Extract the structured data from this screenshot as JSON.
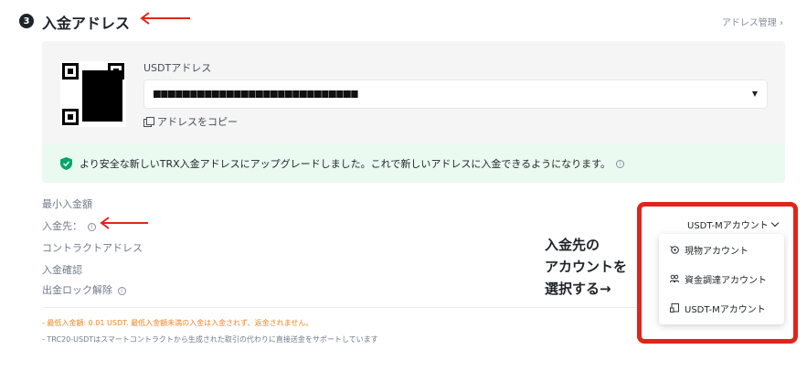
{
  "step": {
    "number": "3",
    "title": "入金アドレス"
  },
  "header": {
    "address_management": "アドレス管理 ›"
  },
  "address": {
    "label": "USDTアドレス",
    "copy_label": "アドレスをコピー"
  },
  "notice": {
    "text": "より安全な新しいTRX入金アドレスにアップグレードしました。これで新しいアドレスに入金できるようになります。"
  },
  "details": {
    "min_deposit": "最小入金額",
    "deposit_to": "入金先：",
    "contract_address": "コントラクトアドレス",
    "deposit_confirm": "入金確認",
    "withdraw_unlock": "出金ロック解除"
  },
  "notes": {
    "line1": "- 最低入金額: 0.01 USDT. 最低入金額未満の入金は入金されず、返金されません。",
    "line2": "- TRC20-USDTはスマートコントラクトから生成された取引の代わりに直接送金をサポートしています"
  },
  "annotation": {
    "line1": "入金先の",
    "line2": "アカウントを",
    "line3": "選択する→"
  },
  "account_select": {
    "selected": "USDT-Mアカウント",
    "options": [
      "現物アカウント",
      "資金調達アカウント",
      "USDT-Mアカウント"
    ]
  },
  "colors": {
    "annotation_red": "#e0251b",
    "notice_bg": "#eafaf1",
    "shield_green": "#03a66d",
    "note_orange": "#f0831e"
  },
  "icons": {
    "step": "step-number-badge",
    "copy": "copy-icon",
    "shield": "shield-check-icon",
    "info": "info-icon",
    "caret": "caret-down-icon"
  }
}
